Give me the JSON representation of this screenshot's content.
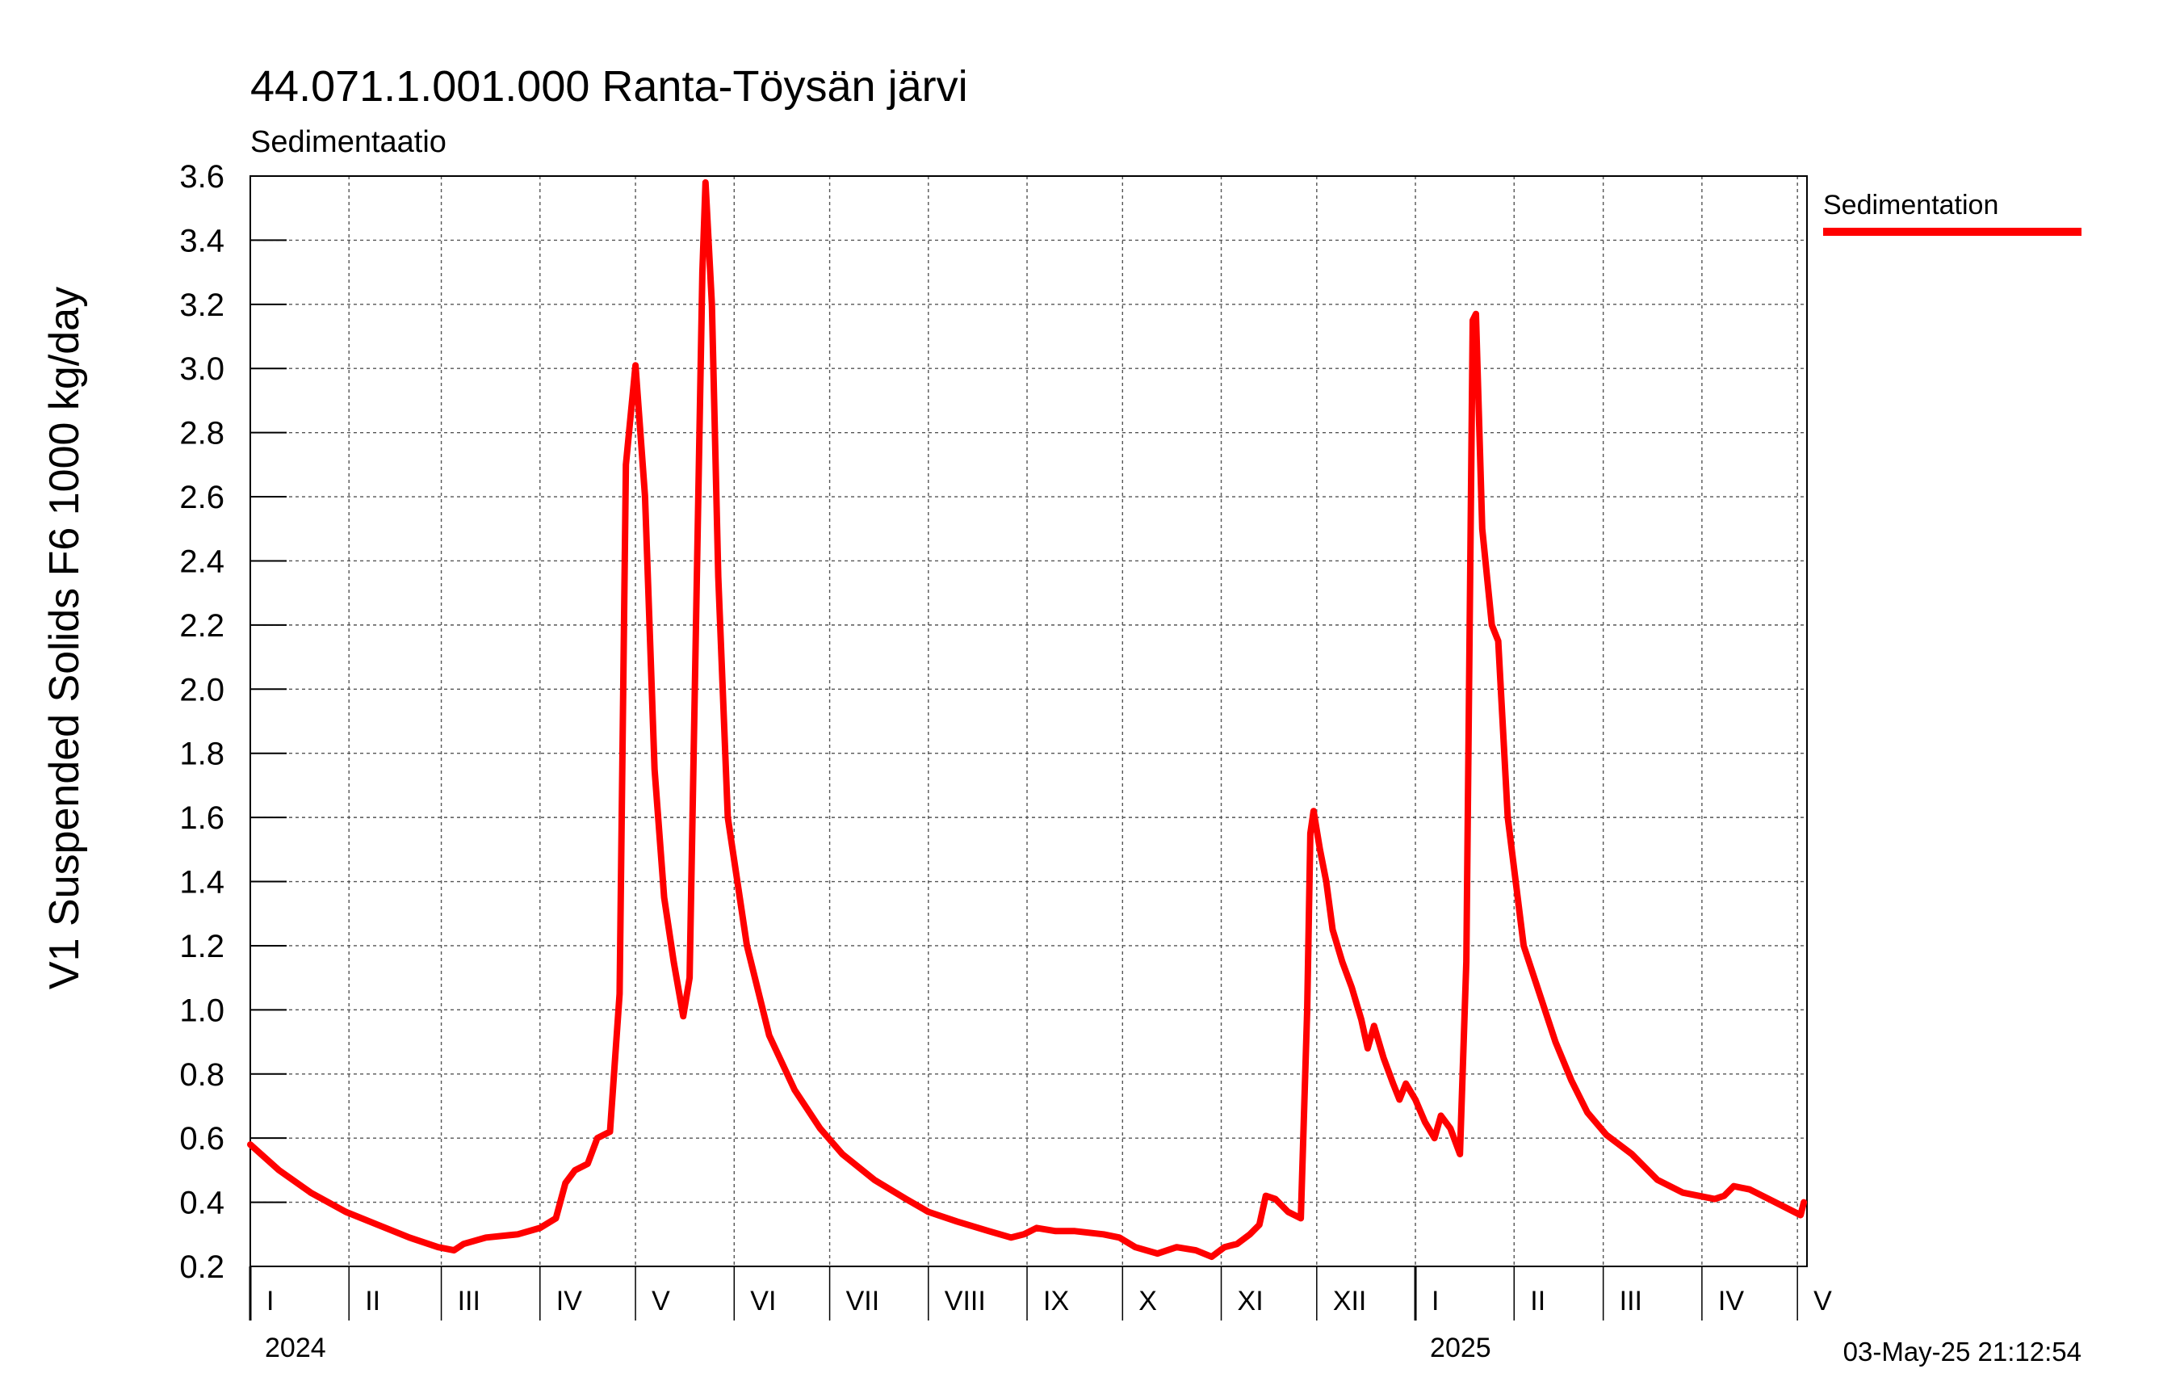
{
  "chart_data": {
    "type": "line",
    "title": "44.071.1.001.000 Ranta-Töysän järvi",
    "subtitle": "Sedimentaatio",
    "ylabel": "V1 Suspended Solids F6 1000 kg/day",
    "xlabel": "",
    "ylim": [
      0.2,
      3.6
    ],
    "yticks": [
      "0.2",
      "0.4",
      "0.6",
      "0.8",
      "1.0",
      "1.2",
      "1.4",
      "1.6",
      "1.8",
      "2.0",
      "2.2",
      "2.4",
      "2.6",
      "2.8",
      "3.0",
      "3.2",
      "3.4",
      "3.6"
    ],
    "xlim": [
      "2024-01-01",
      "2025-05-04"
    ],
    "months": [
      {
        "label": "I",
        "date": "2024-01-01"
      },
      {
        "label": "II",
        "date": "2024-02-01"
      },
      {
        "label": "III",
        "date": "2024-03-01"
      },
      {
        "label": "IV",
        "date": "2024-04-01"
      },
      {
        "label": "V",
        "date": "2024-05-01"
      },
      {
        "label": "VI",
        "date": "2024-06-01"
      },
      {
        "label": "VII",
        "date": "2024-07-01"
      },
      {
        "label": "VIII",
        "date": "2024-08-01"
      },
      {
        "label": "IX",
        "date": "2024-09-01"
      },
      {
        "label": "X",
        "date": "2024-10-01"
      },
      {
        "label": "XI",
        "date": "2024-11-01"
      },
      {
        "label": "XII",
        "date": "2024-12-01"
      },
      {
        "label": "I",
        "date": "2025-01-01"
      },
      {
        "label": "II",
        "date": "2025-02-01"
      },
      {
        "label": "III",
        "date": "2025-03-01"
      },
      {
        "label": "IV",
        "date": "2025-04-01"
      },
      {
        "label": "V",
        "date": "2025-05-01"
      }
    ],
    "years": [
      {
        "label": "2024",
        "date": "2024-01-01"
      },
      {
        "label": "2025",
        "date": "2025-01-01"
      }
    ],
    "grid": true,
    "legend_position": "top-right",
    "series": [
      {
        "name": "Sedimentation",
        "color": "#ff0000",
        "points": [
          [
            "2024-01-01",
            0.58
          ],
          [
            "2024-01-10",
            0.5
          ],
          [
            "2024-01-20",
            0.43
          ],
          [
            "2024-01-31",
            0.37
          ],
          [
            "2024-02-10",
            0.33
          ],
          [
            "2024-02-20",
            0.29
          ],
          [
            "2024-02-29",
            0.26
          ],
          [
            "2024-03-05",
            0.25
          ],
          [
            "2024-03-08",
            0.27
          ],
          [
            "2024-03-15",
            0.29
          ],
          [
            "2024-03-25",
            0.3
          ],
          [
            "2024-04-01",
            0.32
          ],
          [
            "2024-04-06",
            0.35
          ],
          [
            "2024-04-09",
            0.46
          ],
          [
            "2024-04-12",
            0.5
          ],
          [
            "2024-04-16",
            0.52
          ],
          [
            "2024-04-19",
            0.6
          ],
          [
            "2024-04-23",
            0.62
          ],
          [
            "2024-04-26",
            1.05
          ],
          [
            "2024-04-28",
            2.7
          ],
          [
            "2024-05-01",
            3.01
          ],
          [
            "2024-05-04",
            2.6
          ],
          [
            "2024-05-07",
            1.75
          ],
          [
            "2024-05-10",
            1.35
          ],
          [
            "2024-05-13",
            1.15
          ],
          [
            "2024-05-16",
            0.98
          ],
          [
            "2024-05-18",
            1.1
          ],
          [
            "2024-05-20",
            2.2
          ],
          [
            "2024-05-22",
            3.3
          ],
          [
            "2024-05-23",
            3.58
          ],
          [
            "2024-05-25",
            3.2
          ],
          [
            "2024-05-27",
            2.35
          ],
          [
            "2024-05-30",
            1.6
          ],
          [
            "2024-06-05",
            1.2
          ],
          [
            "2024-06-12",
            0.92
          ],
          [
            "2024-06-20",
            0.75
          ],
          [
            "2024-06-28",
            0.63
          ],
          [
            "2024-07-05",
            0.55
          ],
          [
            "2024-07-15",
            0.47
          ],
          [
            "2024-07-25",
            0.41
          ],
          [
            "2024-08-01",
            0.37
          ],
          [
            "2024-08-10",
            0.34
          ],
          [
            "2024-08-20",
            0.31
          ],
          [
            "2024-08-27",
            0.29
          ],
          [
            "2024-08-31",
            0.3
          ],
          [
            "2024-09-04",
            0.32
          ],
          [
            "2024-09-10",
            0.31
          ],
          [
            "2024-09-16",
            0.31
          ],
          [
            "2024-09-25",
            0.3
          ],
          [
            "2024-09-30",
            0.29
          ],
          [
            "2024-10-05",
            0.26
          ],
          [
            "2024-10-12",
            0.24
          ],
          [
            "2024-10-18",
            0.26
          ],
          [
            "2024-10-24",
            0.25
          ],
          [
            "2024-10-29",
            0.23
          ],
          [
            "2024-11-02",
            0.26
          ],
          [
            "2024-11-06",
            0.27
          ],
          [
            "2024-11-10",
            0.3
          ],
          [
            "2024-11-13",
            0.33
          ],
          [
            "2024-11-15",
            0.42
          ],
          [
            "2024-11-18",
            0.41
          ],
          [
            "2024-11-22",
            0.37
          ],
          [
            "2024-11-26",
            0.35
          ],
          [
            "2024-11-28",
            1.0
          ],
          [
            "2024-11-29",
            1.55
          ],
          [
            "2024-11-30",
            1.62
          ],
          [
            "2024-12-02",
            1.5
          ],
          [
            "2024-12-04",
            1.4
          ],
          [
            "2024-12-06",
            1.25
          ],
          [
            "2024-12-09",
            1.15
          ],
          [
            "2024-12-12",
            1.07
          ],
          [
            "2024-12-15",
            0.97
          ],
          [
            "2024-12-17",
            0.88
          ],
          [
            "2024-12-19",
            0.95
          ],
          [
            "2024-12-22",
            0.85
          ],
          [
            "2024-12-25",
            0.77
          ],
          [
            "2024-12-27",
            0.72
          ],
          [
            "2024-12-29",
            0.77
          ],
          [
            "2025-01-01",
            0.72
          ],
          [
            "2025-01-04",
            0.65
          ],
          [
            "2025-01-07",
            0.6
          ],
          [
            "2025-01-09",
            0.67
          ],
          [
            "2025-01-12",
            0.63
          ],
          [
            "2025-01-15",
            0.55
          ],
          [
            "2025-01-17",
            1.15
          ],
          [
            "2025-01-19",
            3.15
          ],
          [
            "2025-01-20",
            3.17
          ],
          [
            "2025-01-22",
            2.5
          ],
          [
            "2025-01-25",
            2.2
          ],
          [
            "2025-01-27",
            2.15
          ],
          [
            "2025-01-30",
            1.6
          ],
          [
            "2025-02-04",
            1.2
          ],
          [
            "2025-02-09",
            1.05
          ],
          [
            "2025-02-14",
            0.9
          ],
          [
            "2025-02-19",
            0.78
          ],
          [
            "2025-02-24",
            0.68
          ],
          [
            "2025-03-02",
            0.61
          ],
          [
            "2025-03-10",
            0.55
          ],
          [
            "2025-03-18",
            0.47
          ],
          [
            "2025-03-26",
            0.43
          ],
          [
            "2025-04-05",
            0.41
          ],
          [
            "2025-04-08",
            0.42
          ],
          [
            "2025-04-11",
            0.45
          ],
          [
            "2025-04-16",
            0.44
          ],
          [
            "2025-04-22",
            0.41
          ],
          [
            "2025-04-28",
            0.38
          ],
          [
            "2025-05-02",
            0.36
          ],
          [
            "2025-05-03",
            0.4
          ]
        ]
      }
    ]
  },
  "timestamp": "03-May-25 21:12:54"
}
